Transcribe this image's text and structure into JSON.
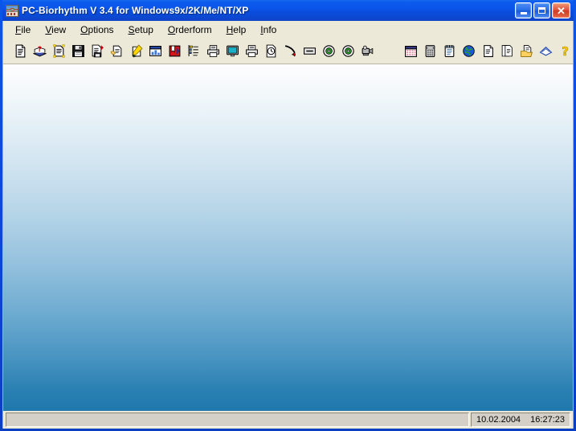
{
  "window": {
    "title": "PC-Biorhythm V 3.4 for Windows9x/2K/Me/NT/XP",
    "app_icon": "biorhythm-chart-icon",
    "controls": {
      "minimize": "_",
      "maximize": "□",
      "close": "✕"
    },
    "colors": {
      "titlebar_blue": "#0a4ddc",
      "close_red": "#cf3c22",
      "toolbar_face": "#ece9d8",
      "client_gradient_top": "#fdfdfe",
      "client_gradient_bottom": "#1f78ad",
      "status_panel": "#d4d0c8"
    }
  },
  "menu": {
    "items": [
      {
        "label": "File",
        "accel": "F"
      },
      {
        "label": "View",
        "accel": "V"
      },
      {
        "label": "Options",
        "accel": "O"
      },
      {
        "label": "Setup",
        "accel": "S"
      },
      {
        "label": "Orderform",
        "accel": "O"
      },
      {
        "label": "Help",
        "accel": "H"
      },
      {
        "label": "Info",
        "accel": "I"
      }
    ]
  },
  "toolbar": {
    "groups": [
      {
        "buttons": [
          {
            "icon": "new-document-icon"
          },
          {
            "icon": "open-book-question-icon"
          },
          {
            "icon": "document-highlight-icon"
          },
          {
            "icon": "save-floppy-icon"
          },
          {
            "icon": "save-as-document-icon"
          },
          {
            "icon": "edit-document-hand-icon"
          },
          {
            "icon": "pencil-write-icon"
          },
          {
            "icon": "form-window-icon"
          },
          {
            "icon": "red-book-icon"
          },
          {
            "icon": "list-tree-icon"
          },
          {
            "icon": "print-icon"
          },
          {
            "icon": "monitor-preview-icon"
          },
          {
            "icon": "print-alt-icon"
          },
          {
            "icon": "document-clock-icon"
          },
          {
            "icon": "red-pen-icon"
          },
          {
            "icon": "label-textbox-icon"
          },
          {
            "icon": "cd-disc-icon"
          },
          {
            "icon": "cd-disc-alt-icon"
          },
          {
            "icon": "camcorder-icon"
          }
        ]
      },
      {
        "buttons": [
          {
            "icon": "calendar-icon"
          },
          {
            "icon": "calculator-icon"
          },
          {
            "icon": "notepad-icon"
          },
          {
            "icon": "globe-world-icon"
          },
          {
            "icon": "document-icon"
          },
          {
            "icon": "copy-documents-icon"
          },
          {
            "icon": "open-folder-document-icon"
          },
          {
            "icon": "blue-book-icon"
          },
          {
            "icon": "help-question-icon"
          },
          {
            "icon": "exit-door-icon"
          }
        ]
      }
    ]
  },
  "client": {
    "content": ""
  },
  "statusbar": {
    "message": "",
    "date": "10.02.2004",
    "time": "16:27:23"
  }
}
